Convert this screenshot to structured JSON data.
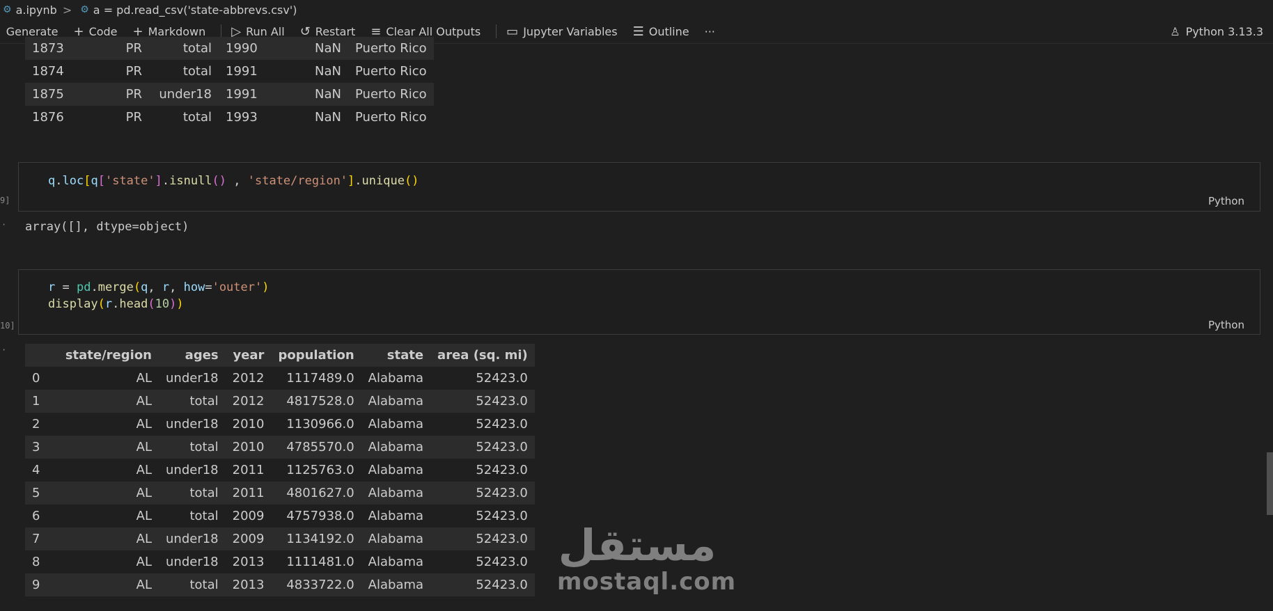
{
  "breadcrumb": {
    "file": "a.ipynb",
    "separator": ">",
    "cell": "a = pd.read_csv('state-abbrevs.csv')"
  },
  "toolbar": {
    "generate": "Generate",
    "code": "Code",
    "markdown": "Markdown",
    "run_all": "Run All",
    "restart": "Restart",
    "clear_outputs": "Clear All Outputs",
    "variables": "Jupyter Variables",
    "outline": "Outline",
    "more": "···",
    "kernel": "Python 3.13.3"
  },
  "table1": {
    "rows": [
      [
        "1873",
        "PR",
        "total",
        "1990",
        "NaN",
        "Puerto Rico"
      ],
      [
        "1874",
        "PR",
        "total",
        "1991",
        "NaN",
        "Puerto Rico"
      ],
      [
        "1875",
        "PR",
        "under18",
        "1991",
        "NaN",
        "Puerto Rico"
      ],
      [
        "1876",
        "PR",
        "total",
        "1993",
        "NaN",
        "Puerto Rico"
      ]
    ]
  },
  "cell9": {
    "exec": "9]",
    "lang": "Python",
    "output_prompt": "·",
    "output": "array([], dtype=object)"
  },
  "cell10": {
    "exec": "10]",
    "lang": "Python",
    "output_prompt": "·"
  },
  "table2": {
    "columns": [
      "state/region",
      "ages",
      "year",
      "population",
      "state",
      "area (sq. mi)"
    ],
    "rows": [
      [
        "0",
        "AL",
        "under18",
        "2012",
        "1117489.0",
        "Alabama",
        "52423.0"
      ],
      [
        "1",
        "AL",
        "total",
        "2012",
        "4817528.0",
        "Alabama",
        "52423.0"
      ],
      [
        "2",
        "AL",
        "under18",
        "2010",
        "1130966.0",
        "Alabama",
        "52423.0"
      ],
      [
        "3",
        "AL",
        "total",
        "2010",
        "4785570.0",
        "Alabama",
        "52423.0"
      ],
      [
        "4",
        "AL",
        "under18",
        "2011",
        "1125763.0",
        "Alabama",
        "52423.0"
      ],
      [
        "5",
        "AL",
        "total",
        "2011",
        "4801627.0",
        "Alabama",
        "52423.0"
      ],
      [
        "6",
        "AL",
        "total",
        "2009",
        "4757938.0",
        "Alabama",
        "52423.0"
      ],
      [
        "7",
        "AL",
        "under18",
        "2009",
        "1134192.0",
        "Alabama",
        "52423.0"
      ],
      [
        "8",
        "AL",
        "under18",
        "2013",
        "1111481.0",
        "Alabama",
        "52423.0"
      ],
      [
        "9",
        "AL",
        "total",
        "2013",
        "4833722.0",
        "Alabama",
        "52423.0"
      ]
    ]
  },
  "watermark": {
    "arabic": "مستقل",
    "latin": "mostaql.com"
  },
  "colors": {
    "background": "#1f1f1f",
    "cell_background": "#1e1e1e",
    "cell_border": "#3c3c3c",
    "row_stripe": "#2c2c2c"
  }
}
